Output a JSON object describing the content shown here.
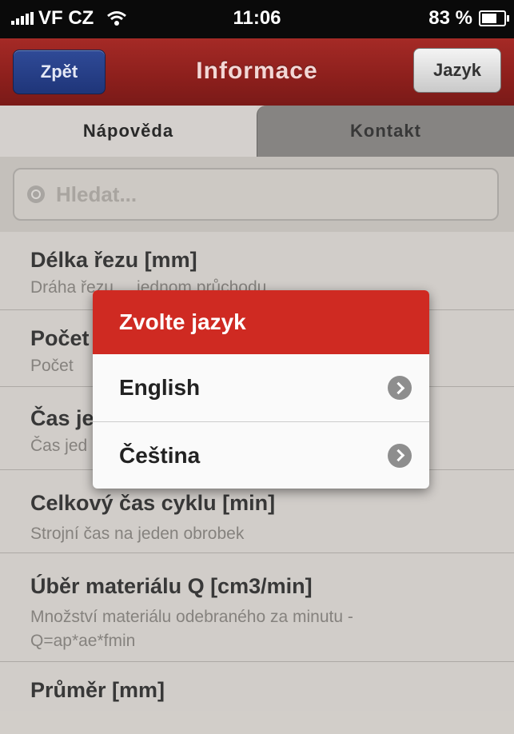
{
  "status_bar": {
    "carrier": "VF CZ",
    "time": "11:06",
    "battery": "83 %",
    "battery_level": 0.83
  },
  "nav": {
    "back_label": "Zpět",
    "title": "Informace",
    "language_label": "Jazyk"
  },
  "tabs": [
    {
      "label": "Nápověda",
      "active": true
    },
    {
      "label": "Kontakt",
      "active": false
    }
  ],
  "search": {
    "placeholder": "Hledat..."
  },
  "list": [
    {
      "title": "Délka řezu [mm]",
      "subtitle": "Dráha řezu ... jednom průchodu"
    },
    {
      "title": "Počet",
      "subtitle": "Počet"
    },
    {
      "title": "Čas je",
      "subtitle": "Čas jed"
    },
    {
      "title": "Celkový čas cyklu [min]",
      "subtitle": "Strojní čas na jeden obrobek"
    },
    {
      "title": "Úběr materiálu Q [cm3/min]",
      "subtitle": "Množství materiálu odebraného za minutu - Q=ap*ae*fmin"
    },
    {
      "title": "Průměr [mm]",
      "subtitle": ""
    }
  ],
  "modal": {
    "title": "Zvolte jazyk",
    "options": [
      {
        "label": "English"
      },
      {
        "label": "Čeština"
      }
    ]
  },
  "colors": {
    "navbar": "#8c1f1c",
    "modal_header": "#cf2a22",
    "back_button": "#2f4a97"
  }
}
